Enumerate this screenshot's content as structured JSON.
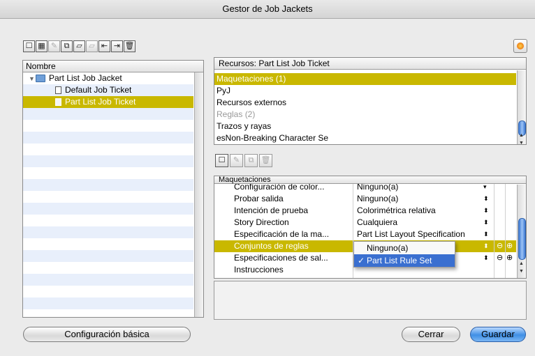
{
  "window": {
    "title": "Gestor de Job Jackets"
  },
  "toolbar_icons": [
    "new-jacket-icon",
    "new-ticket-icon",
    "edit-icon",
    "duplicate-icon",
    "open-icon",
    "save-icon",
    "import-icon",
    "export-icon",
    "delete-icon"
  ],
  "left_panel": {
    "column_header": "Nombre",
    "tree": [
      {
        "label": "Part List Job Jacket",
        "type": "jacket",
        "level": 0,
        "selected": false
      },
      {
        "label": "Default Job Ticket",
        "type": "ticket",
        "level": 1,
        "selected": false
      },
      {
        "label": "Part List Job Ticket",
        "type": "ticket",
        "level": 1,
        "selected": true
      }
    ]
  },
  "resources_panel": {
    "header": "Recursos: Part List Job Ticket",
    "items": [
      {
        "label": "Maquetaciones (1)",
        "selected": true,
        "dim": false
      },
      {
        "label": "PyJ",
        "selected": false,
        "dim": false
      },
      {
        "label": "Recursos externos",
        "selected": false,
        "dim": false
      },
      {
        "label": "Reglas (2)",
        "selected": false,
        "dim": true
      },
      {
        "label": "Trazos y rayas",
        "selected": false,
        "dim": false
      },
      {
        "label": "esNon-Breaking Character Se",
        "selected": false,
        "dim": false
      }
    ]
  },
  "layouts_panel": {
    "header": "Maquetaciones",
    "rows": [
      {
        "name": "Configuración de color...",
        "value": "Ninguno(a)"
      },
      {
        "name": "Probar salida",
        "value": "Ninguno(a)"
      },
      {
        "name": "Intención de prueba",
        "value": "Colorimétrica relativa"
      },
      {
        "name": "Story Direction",
        "value": "Cualquiera"
      },
      {
        "name": "Especificación de la ma...",
        "value": "Part List Layout Specification"
      },
      {
        "name": "Conjuntos de reglas",
        "value": "",
        "selected": true
      },
      {
        "name": "Especificaciones de sal...",
        "value": ""
      },
      {
        "name": "Instrucciones",
        "value": ""
      }
    ]
  },
  "popup_menu": {
    "options": [
      {
        "label": "Ninguno(a)",
        "checked": false,
        "highlighted": false
      },
      {
        "label": "Part List Rule Set",
        "checked": true,
        "highlighted": true
      }
    ],
    "check_mark": "✓"
  },
  "buttons": {
    "basic_config": "Configuración básica",
    "close": "Cerrar",
    "save": "Guardar"
  },
  "colors": {
    "selection": "#c9b800",
    "menu_highlight": "#3a6fd0",
    "stripe": "#e8effb"
  }
}
